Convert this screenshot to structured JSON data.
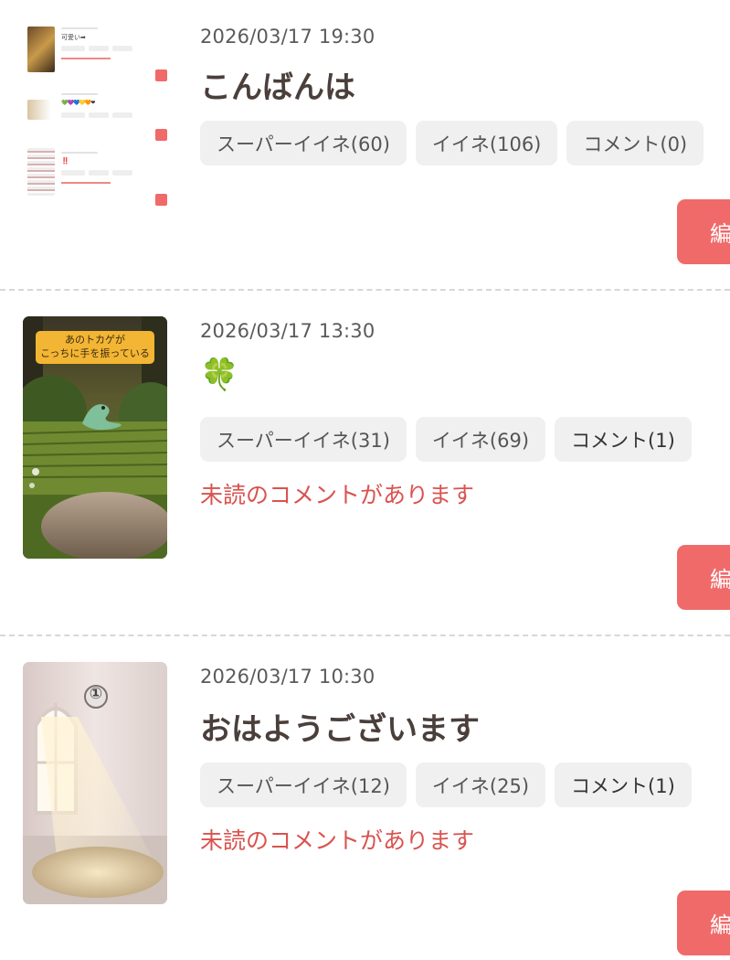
{
  "posts": [
    {
      "date": "2026/03/17 19:30",
      "title": "こんばんは",
      "super_like": "スーパーイイネ(60)",
      "like": "イイネ(106)",
      "comment": "コメント(0)",
      "unread": "",
      "edit_label": "編",
      "thumb": {
        "type": "screenshot-preview",
        "entries": [
          {
            "date": "2026/03/17 19:30",
            "title": "可愛い➡",
            "unread": "未読のコメントがあります"
          },
          {
            "date": "2026/03/17 16:30",
            "title": "💚💜💙💛🧡❤",
            "unread": ""
          },
          {
            "date": "2026/03/17 13:30",
            "title": "‼️",
            "unread": "未読のコメントがあります"
          }
        ]
      }
    },
    {
      "date": "2026/03/17 13:30",
      "title": "🍀",
      "super_like": "スーパーイイネ(31)",
      "like": "イイネ(69)",
      "comment": "コメント(1)",
      "unread": "未読のコメントがあります",
      "edit_label": "編",
      "thumb": {
        "type": "lizard-scene",
        "caption_line1": "あのトカゲが",
        "caption_line2": "こっちに手を振っている"
      }
    },
    {
      "date": "2026/03/17 10:30",
      "title": "おはようございます",
      "super_like": "スーパーイイネ(12)",
      "like": "イイネ(25)",
      "comment": "コメント(1)",
      "unread": "未読のコメントがあります",
      "edit_label": "編",
      "thumb": {
        "type": "sunlit-room",
        "badge": "①"
      }
    }
  ],
  "colors": {
    "accent": "#f06a6a",
    "unread_text": "#d9534f",
    "tag_bg": "#f0f0f0",
    "title_text": "#4a3f3b"
  }
}
